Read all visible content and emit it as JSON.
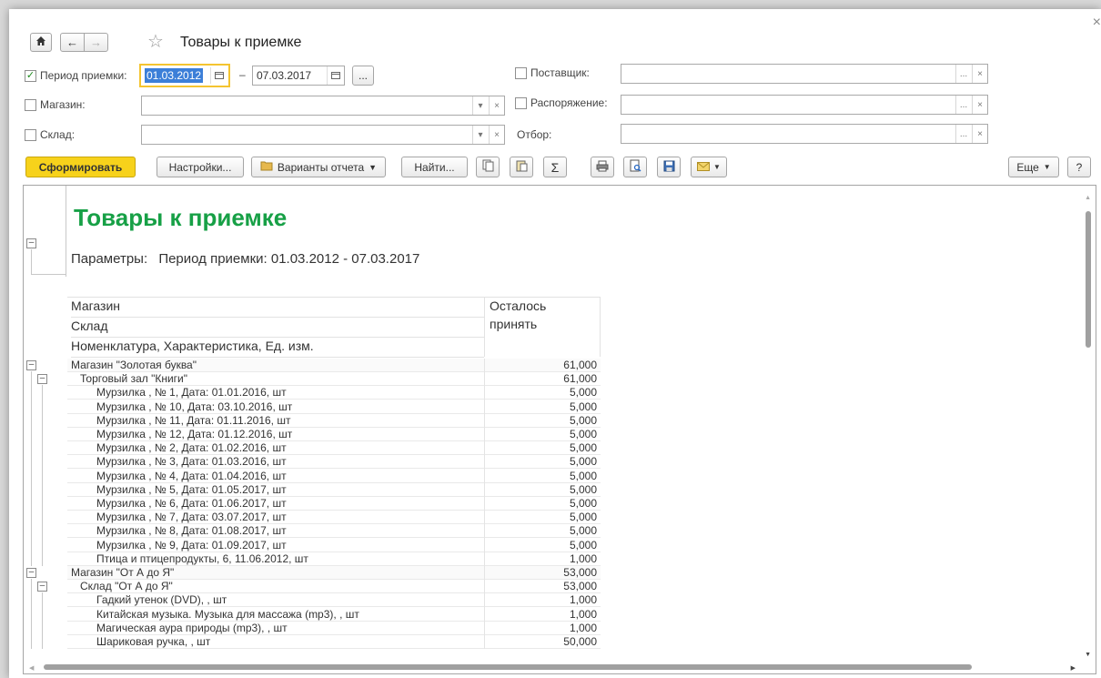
{
  "window": {
    "title": "Товары к приемке",
    "close": "×"
  },
  "nav": {
    "home": "⌂",
    "back": "←",
    "forward": "→",
    "star": "☆"
  },
  "filters": {
    "period_label": "Период приемки:",
    "period_checked": true,
    "date_from": "01.03.2012",
    "date_to": "07.03.2017",
    "dash": "–",
    "ellipsis": "...",
    "store_label": "Магазин:",
    "warehouse_label": "Склад:",
    "supplier_label": "Поставщик:",
    "order_label": "Распоряжение:",
    "selection_label": "Отбор:"
  },
  "toolbar": {
    "generate": "Сформировать",
    "settings": "Настройки...",
    "variants": "Варианты отчета",
    "find": "Найти...",
    "sigma": "Σ",
    "more": "Еще",
    "help": "?",
    "accent": "#f7d21b"
  },
  "report": {
    "title": "Товары к приемке",
    "params_label": "Параметры:",
    "params_value": "Период приемки: 01.03.2012 - 07.03.2017",
    "header": {
      "col1_line1": "Магазин",
      "col1_line2": "Склад",
      "col1_line3": "Номенклатура, Характеристика, Ед. изм.",
      "col2_line1": "Осталось",
      "col2_line2": "принять"
    },
    "rows": [
      {
        "level": 0,
        "name": "Магазин \"Золотая буква\"",
        "value": "61,000"
      },
      {
        "level": 1,
        "name": "Торговый зал \"Книги\"",
        "value": "61,000"
      },
      {
        "level": 2,
        "name": "Мурзилка , № 1, Дата: 01.01.2016, шт",
        "value": "5,000"
      },
      {
        "level": 2,
        "name": "Мурзилка , № 10, Дата: 03.10.2016, шт",
        "value": "5,000"
      },
      {
        "level": 2,
        "name": "Мурзилка , № 11, Дата: 01.11.2016, шт",
        "value": "5,000"
      },
      {
        "level": 2,
        "name": "Мурзилка , № 12, Дата: 01.12.2016, шт",
        "value": "5,000"
      },
      {
        "level": 2,
        "name": "Мурзилка , № 2, Дата: 01.02.2016, шт",
        "value": "5,000"
      },
      {
        "level": 2,
        "name": "Мурзилка , № 3, Дата: 01.03.2016, шт",
        "value": "5,000"
      },
      {
        "level": 2,
        "name": "Мурзилка , № 4, Дата: 01.04.2016, шт",
        "value": "5,000"
      },
      {
        "level": 2,
        "name": "Мурзилка , № 5, Дата: 01.05.2017, шт",
        "value": "5,000"
      },
      {
        "level": 2,
        "name": "Мурзилка , № 6, Дата: 01.06.2017, шт",
        "value": "5,000"
      },
      {
        "level": 2,
        "name": "Мурзилка , № 7, Дата: 03.07.2017, шт",
        "value": "5,000"
      },
      {
        "level": 2,
        "name": "Мурзилка , № 8, Дата: 01.08.2017, шт",
        "value": "5,000"
      },
      {
        "level": 2,
        "name": "Мурзилка , № 9, Дата: 01.09.2017, шт",
        "value": "5,000"
      },
      {
        "level": 2,
        "name": "Птица и птицепродукты, 6, 11.06.2012, шт",
        "value": "1,000"
      },
      {
        "level": 0,
        "name": "Магазин \"От А до Я\"",
        "value": "53,000"
      },
      {
        "level": 1,
        "name": "Склад \"От А до Я\"",
        "value": "53,000"
      },
      {
        "level": 2,
        "name": "Гадкий утенок (DVD), , шт",
        "value": "1,000"
      },
      {
        "level": 2,
        "name": "Китайская музыка. Музыка для массажа (mp3), , шт",
        "value": "1,000"
      },
      {
        "level": 2,
        "name": "Магическая аура природы (mp3), , шт",
        "value": "1,000"
      },
      {
        "level": 2,
        "name": "Шариковая ручка, , шт",
        "value": "50,000"
      }
    ],
    "title_color": "#17a046"
  }
}
